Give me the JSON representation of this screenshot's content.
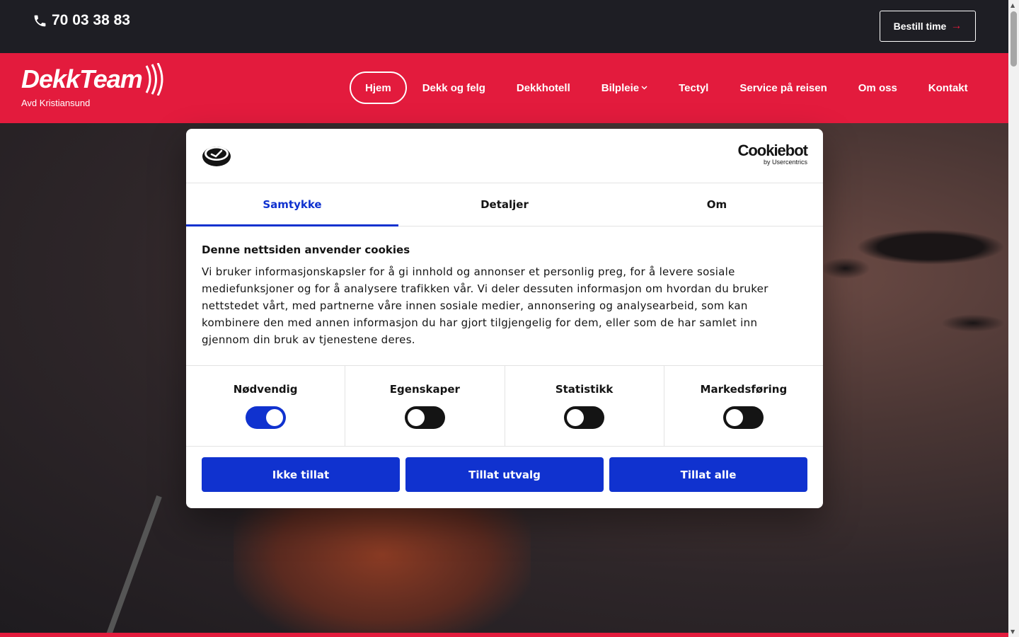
{
  "header": {
    "phone": "70 03 38 83",
    "book_label": "Bestill time",
    "book_arrow": "→"
  },
  "brand": {
    "logo_text": "DekkTeam",
    "subtitle": "Avd Kristiansund"
  },
  "nav": {
    "items": [
      {
        "label": "Hjem",
        "active": true
      },
      {
        "label": "Dekk og felg"
      },
      {
        "label": "Dekkhotell"
      },
      {
        "label": "Bilpleie",
        "has_dropdown": true
      },
      {
        "label": "Tectyl"
      },
      {
        "label": "Service på reisen"
      },
      {
        "label": "Om oss"
      },
      {
        "label": "Kontakt"
      }
    ],
    "dropdown_icon": "chevron-down-icon"
  },
  "cookie_dialog": {
    "brand_main": "Cookiebot",
    "brand_sub": "by Usercentrics",
    "tabs": [
      {
        "label": "Samtykke",
        "active": true
      },
      {
        "label": "Detaljer"
      },
      {
        "label": "Om"
      }
    ],
    "heading": "Denne nettsiden anvender cookies",
    "text": "Vi bruker informasjonskapsler for å gi innhold og annonser et personlig preg, for å levere sosiale mediefunksjoner og for å analysere trafikken vår. Vi deler dessuten informasjon om hvordan du bruker nettstedet vårt, med partnerne våre innen sosiale medier, annonsering og analysearbeid, som kan kombinere den med annen informasjon du har gjort tilgjengelig for dem, eller som de har samlet inn gjennom din bruk av tjenestene deres.",
    "toggles": [
      {
        "label": "Nødvendig",
        "on": true
      },
      {
        "label": "Egenskaper",
        "on": false
      },
      {
        "label": "Statistikk",
        "on": false
      },
      {
        "label": "Markedsføring",
        "on": false
      }
    ],
    "buttons": {
      "deny": "Ikke tillat",
      "allow_selection": "Tillat utvalg",
      "allow_all": "Tillat alle"
    }
  },
  "colors": {
    "brand_red": "#e31b3d",
    "dark": "#1e1e24",
    "cookiebot_blue": "#1032cf"
  }
}
